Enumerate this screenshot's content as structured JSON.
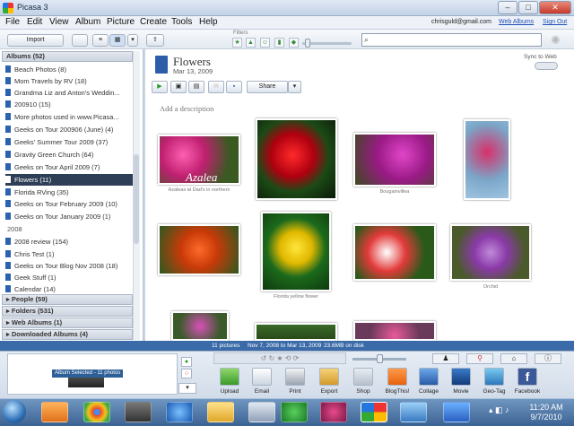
{
  "window": {
    "title": "Picasa 3",
    "minimize": "–",
    "maximize": "□",
    "close": "✕"
  },
  "menu": [
    "File",
    "Edit",
    "View",
    "Album",
    "Picture",
    "Create",
    "Tools",
    "Help"
  ],
  "account": {
    "email": "chrisguld@gmail.com",
    "web_albums": "Web Albums",
    "sign_out": "Sign Out"
  },
  "toolbar": {
    "import_label": "Import",
    "filters_label": "Filters"
  },
  "search": {
    "placeholder": ""
  },
  "sidebar": {
    "albums_header": "Albums (52)",
    "items": [
      {
        "label": "Beach Photos (8)"
      },
      {
        "label": "Mom Travels by RV (18)"
      },
      {
        "label": "Grandma Liz and Anton's Weddin..."
      },
      {
        "label": "200910 (15)"
      },
      {
        "label": "More photos used in www.Picasa..."
      },
      {
        "label": "Geeks on Tour 200906 (June) (4)"
      },
      {
        "label": "Geeks' Summer Tour 2009 (37)"
      },
      {
        "label": "Gravity Green Church (64)"
      },
      {
        "label": "Geeks on Tour April 2009 (7)"
      },
      {
        "label": "Flowers (11)",
        "selected": true
      },
      {
        "label": "Florida RVing (35)"
      },
      {
        "label": "Geeks on Tour February 2009 (10)"
      },
      {
        "label": "Geeks on Tour January 2009 (1)"
      }
    ],
    "group_2008": "2008",
    "items_2008": [
      {
        "label": "2008 review (154)"
      },
      {
        "label": "Chris Test (1)"
      },
      {
        "label": "Geeks on Tour Blog Nov 2008 (18)"
      },
      {
        "label": "Geek Stuff (1)"
      },
      {
        "label": "Calendar (14)"
      }
    ],
    "sections": [
      "People (59)",
      "Folders (531)",
      "Web Albums (1)",
      "Downloaded Albums (4)"
    ]
  },
  "album": {
    "title": "Flowers",
    "date": "Mar 13, 2009",
    "sync_label": "Sync to Web",
    "share_label": "Share",
    "add_description": "Add a description",
    "captions": [
      "Azaleas at Dad's in northern",
      "Bougainvillea",
      "Florida yellow flower",
      "Orchid"
    ],
    "photo_overlay": "Azalea"
  },
  "status": {
    "count": "11 pictures",
    "dates": "Nov 7, 2008 to Mar 13, 2009",
    "size": "23.6MB on disk"
  },
  "tray": {
    "selection_label": "Album Selected - 11 photos",
    "actions": [
      "Upload",
      "Email",
      "Print",
      "Export",
      "Shop",
      "BlogThis!",
      "Collage",
      "Movie",
      "Geo-Tag",
      "Facebook"
    ]
  },
  "clock": {
    "time": "11:20 AM",
    "date": "9/7/2010"
  },
  "colors": {
    "accent": "#3a6ba8",
    "selected": "#2d3e56",
    "link": "#1f4fb5"
  }
}
